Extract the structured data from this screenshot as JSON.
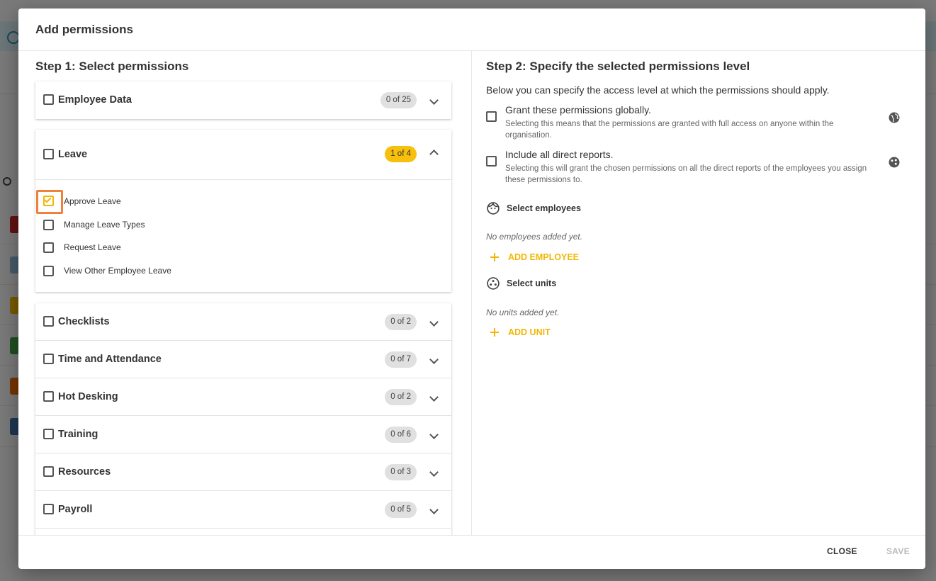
{
  "modal": {
    "title": "Add permissions",
    "close_label": "CLOSE",
    "save_label": "SAVE"
  },
  "left": {
    "step_title": "Step 1: Select permissions",
    "groups": [
      {
        "label": "Employee Data",
        "badge": "0 of 25",
        "expanded": false
      },
      {
        "label": "Leave",
        "badge": "1 of 4",
        "expanded": true,
        "items": [
          {
            "label": "Approve Leave",
            "checked": true
          },
          {
            "label": "Manage Leave Types",
            "checked": false
          },
          {
            "label": "Request Leave",
            "checked": false
          },
          {
            "label": "View Other Employee Leave",
            "checked": false
          }
        ]
      },
      {
        "label": "Checklists",
        "badge": "0 of 2",
        "expanded": false
      },
      {
        "label": "Time and Attendance",
        "badge": "0 of 7",
        "expanded": false
      },
      {
        "label": "Hot Desking",
        "badge": "0 of 2",
        "expanded": false
      },
      {
        "label": "Training",
        "badge": "0 of 6",
        "expanded": false
      },
      {
        "label": "Resources",
        "badge": "0 of 3",
        "expanded": false
      },
      {
        "label": "Payroll",
        "badge": "0 of 5",
        "expanded": false
      }
    ]
  },
  "right": {
    "step_title": "Step 2: Specify the selected permissions level",
    "intro": "Below you can specify the access level at which the permissions should apply.",
    "global": {
      "title": "Grant these permissions globally.",
      "desc": "Selecting this means that the permissions are granted with full access on anyone within the organisation.",
      "icon": "globe-icon"
    },
    "reports": {
      "title": "Include all direct reports.",
      "desc": "Selecting this will grant the chosen permissions on all the direct reports of the employees you assign these permissions to.",
      "icon": "group-icon"
    },
    "employees": {
      "label": "Select employees",
      "empty": "No employees added yet.",
      "add_label": "ADD EMPLOYEE"
    },
    "units": {
      "label": "Select units",
      "empty": "No units added yet.",
      "add_label": "ADD UNIT"
    }
  },
  "colors": {
    "accent": "#f2b705",
    "highlight": "#f0803a"
  }
}
